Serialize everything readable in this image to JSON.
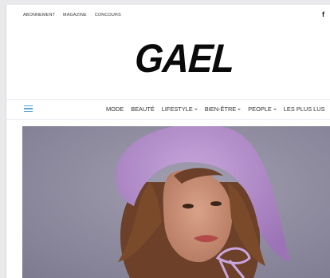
{
  "topbar": {
    "links": [
      "ABONNEMENT",
      "MAGAZINE",
      "CONCOURS"
    ],
    "facebook_icon": "facebook-icon"
  },
  "logo": {
    "text": "GAEL"
  },
  "nav": {
    "menu_icon": "hamburger-icon",
    "items": [
      {
        "label": "MODE",
        "dropdown": false
      },
      {
        "label": "BEAUTÉ",
        "dropdown": false
      },
      {
        "label": "LIFESTYLE",
        "dropdown": true
      },
      {
        "label": "BIEN-ÊTRE",
        "dropdown": true
      },
      {
        "label": "PEOPLE",
        "dropdown": true
      },
      {
        "label": "LES PLUS LUS",
        "dropdown": false
      }
    ]
  },
  "hero": {
    "image": "portrait-woman-lilac-hat",
    "colors": {
      "background": "#8d8a9d",
      "hat": "#b591cc",
      "hair": "#7a4a2a",
      "skin": "#c98f75"
    }
  }
}
